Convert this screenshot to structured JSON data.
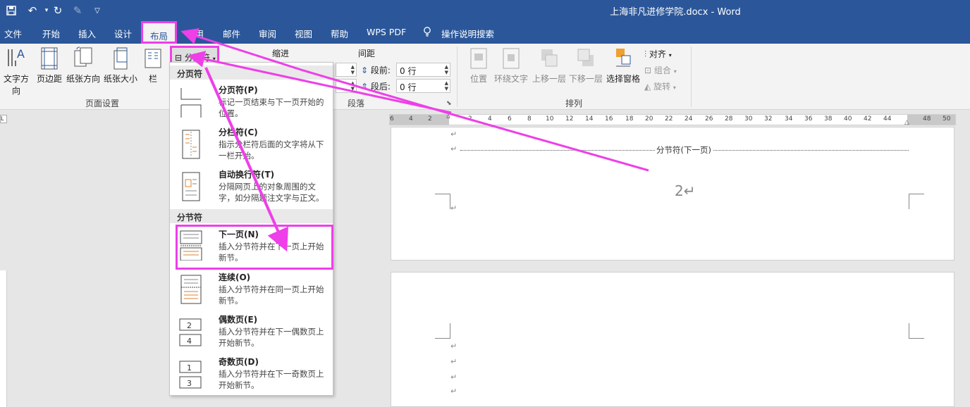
{
  "window": {
    "title": "上海非凡进修学院.docx  -  Word"
  },
  "tabs": [
    {
      "label": "文件"
    },
    {
      "label": "开始"
    },
    {
      "label": "插入"
    },
    {
      "label": "设计"
    },
    {
      "label": "布局"
    },
    {
      "label": "引用"
    },
    {
      "label": "邮件"
    },
    {
      "label": "审阅"
    },
    {
      "label": "视图"
    },
    {
      "label": "帮助"
    },
    {
      "label": "WPS PDF"
    },
    {
      "label": "操作说明搜索"
    }
  ],
  "ribbon": {
    "page_setup": {
      "group_label": "页面设置",
      "text_direction": "文字方向",
      "margins": "页边距",
      "orientation": "纸张方向",
      "size": "纸张大小",
      "columns": "栏"
    },
    "breaks_button": "分隔符",
    "paragraph": {
      "group_label": "段落",
      "indent_label": "缩进",
      "spacing_label": "间距",
      "before_label": "段前:",
      "before_value": "0 行",
      "after_label": "段后:",
      "after_value": "0 行"
    },
    "arrange": {
      "group_label": "排列",
      "position": "位置",
      "wrap_text": "环绕文字",
      "bring_forward": "上移一层",
      "send_backward": "下移一层",
      "selection_pane": "选择窗格",
      "align": "对齐",
      "group": "组合",
      "rotate": "旋转"
    }
  },
  "dropdown": {
    "page_breaks_header": "分页符",
    "section_breaks_header": "分节符",
    "items": [
      {
        "title": "分页符(P)",
        "desc": "标记一页结束与下一页开始的位置。"
      },
      {
        "title": "分栏符(C)",
        "desc": "指示分栏符后面的文字将从下一栏开始。"
      },
      {
        "title": "自动换行符(T)",
        "desc": "分隔网页上的对象周围的文字，如分隔题注文字与正文。"
      },
      {
        "title": "下一页(N)",
        "desc": "插入分节符并在下一页上开始新节。"
      },
      {
        "title": "连续(O)",
        "desc": "插入分节符并在同一页上开始新节。"
      },
      {
        "title": "偶数页(E)",
        "desc": "插入分节符并在下一偶数页上开始新节。"
      },
      {
        "title": "奇数页(D)",
        "desc": "插入分节符并在下一奇数页上开始新节。"
      }
    ]
  },
  "ruler": {
    "numbers": [
      "6",
      "4",
      "2",
      "2",
      "4",
      "6",
      "8",
      "10",
      "12",
      "14",
      "16",
      "18",
      "20",
      "22",
      "24",
      "26",
      "28",
      "30",
      "32",
      "34",
      "36",
      "38",
      "40",
      "42",
      "44",
      "48",
      "50"
    ]
  },
  "document": {
    "section_break_text": "分节符(下一页)",
    "page_number": "2↵",
    "para_mark": "↵"
  },
  "colors": {
    "title_bar": "#2b579a",
    "annotation": "#ee3fe8"
  }
}
